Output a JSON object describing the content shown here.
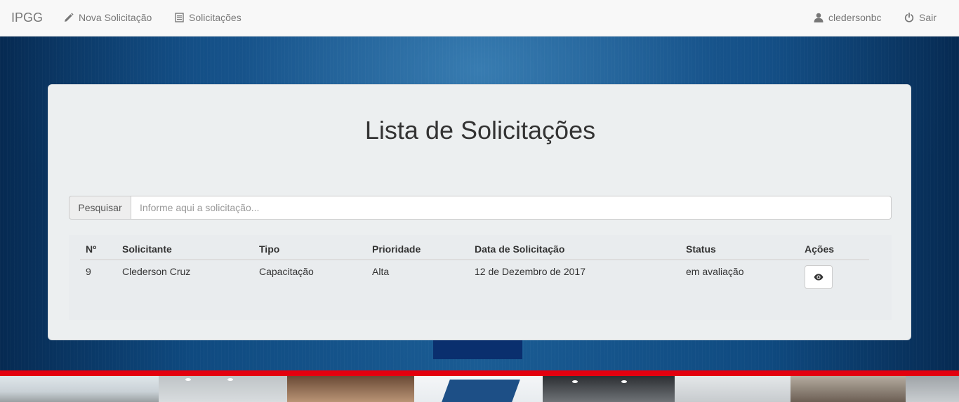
{
  "navbar": {
    "brand": "IPGG",
    "links": {
      "new_request": {
        "label": "Nova Solicitação",
        "icon": "pencil-icon"
      },
      "requests": {
        "label": "Solicitações",
        "icon": "list-icon"
      }
    },
    "user": {
      "label": "cledersonbc",
      "icon": "user-icon"
    },
    "logout": {
      "label": "Sair",
      "icon": "power-icon"
    }
  },
  "main": {
    "title": "Lista de Solicitações",
    "search": {
      "addon_label": "Pesquisar",
      "placeholder": "Informe aqui a solicitação...",
      "value": ""
    },
    "table": {
      "columns": [
        "Nº",
        "Solicitante",
        "Tipo",
        "Prioridade",
        "Data de Solicitação",
        "Status",
        "Ações"
      ],
      "rows": [
        {
          "number": "9",
          "requester": "Clederson Cruz",
          "type": "Capacitação",
          "priority": "Alta",
          "date": "12 de Dezembro de 2017",
          "status": "em avaliação",
          "action_icon": "eye-icon"
        }
      ]
    }
  },
  "colors": {
    "navbar_bg": "#f8f8f8",
    "accent_red": "#e3000f",
    "background_blue": "#0f4a80",
    "panel_bg": "#eceff0"
  }
}
